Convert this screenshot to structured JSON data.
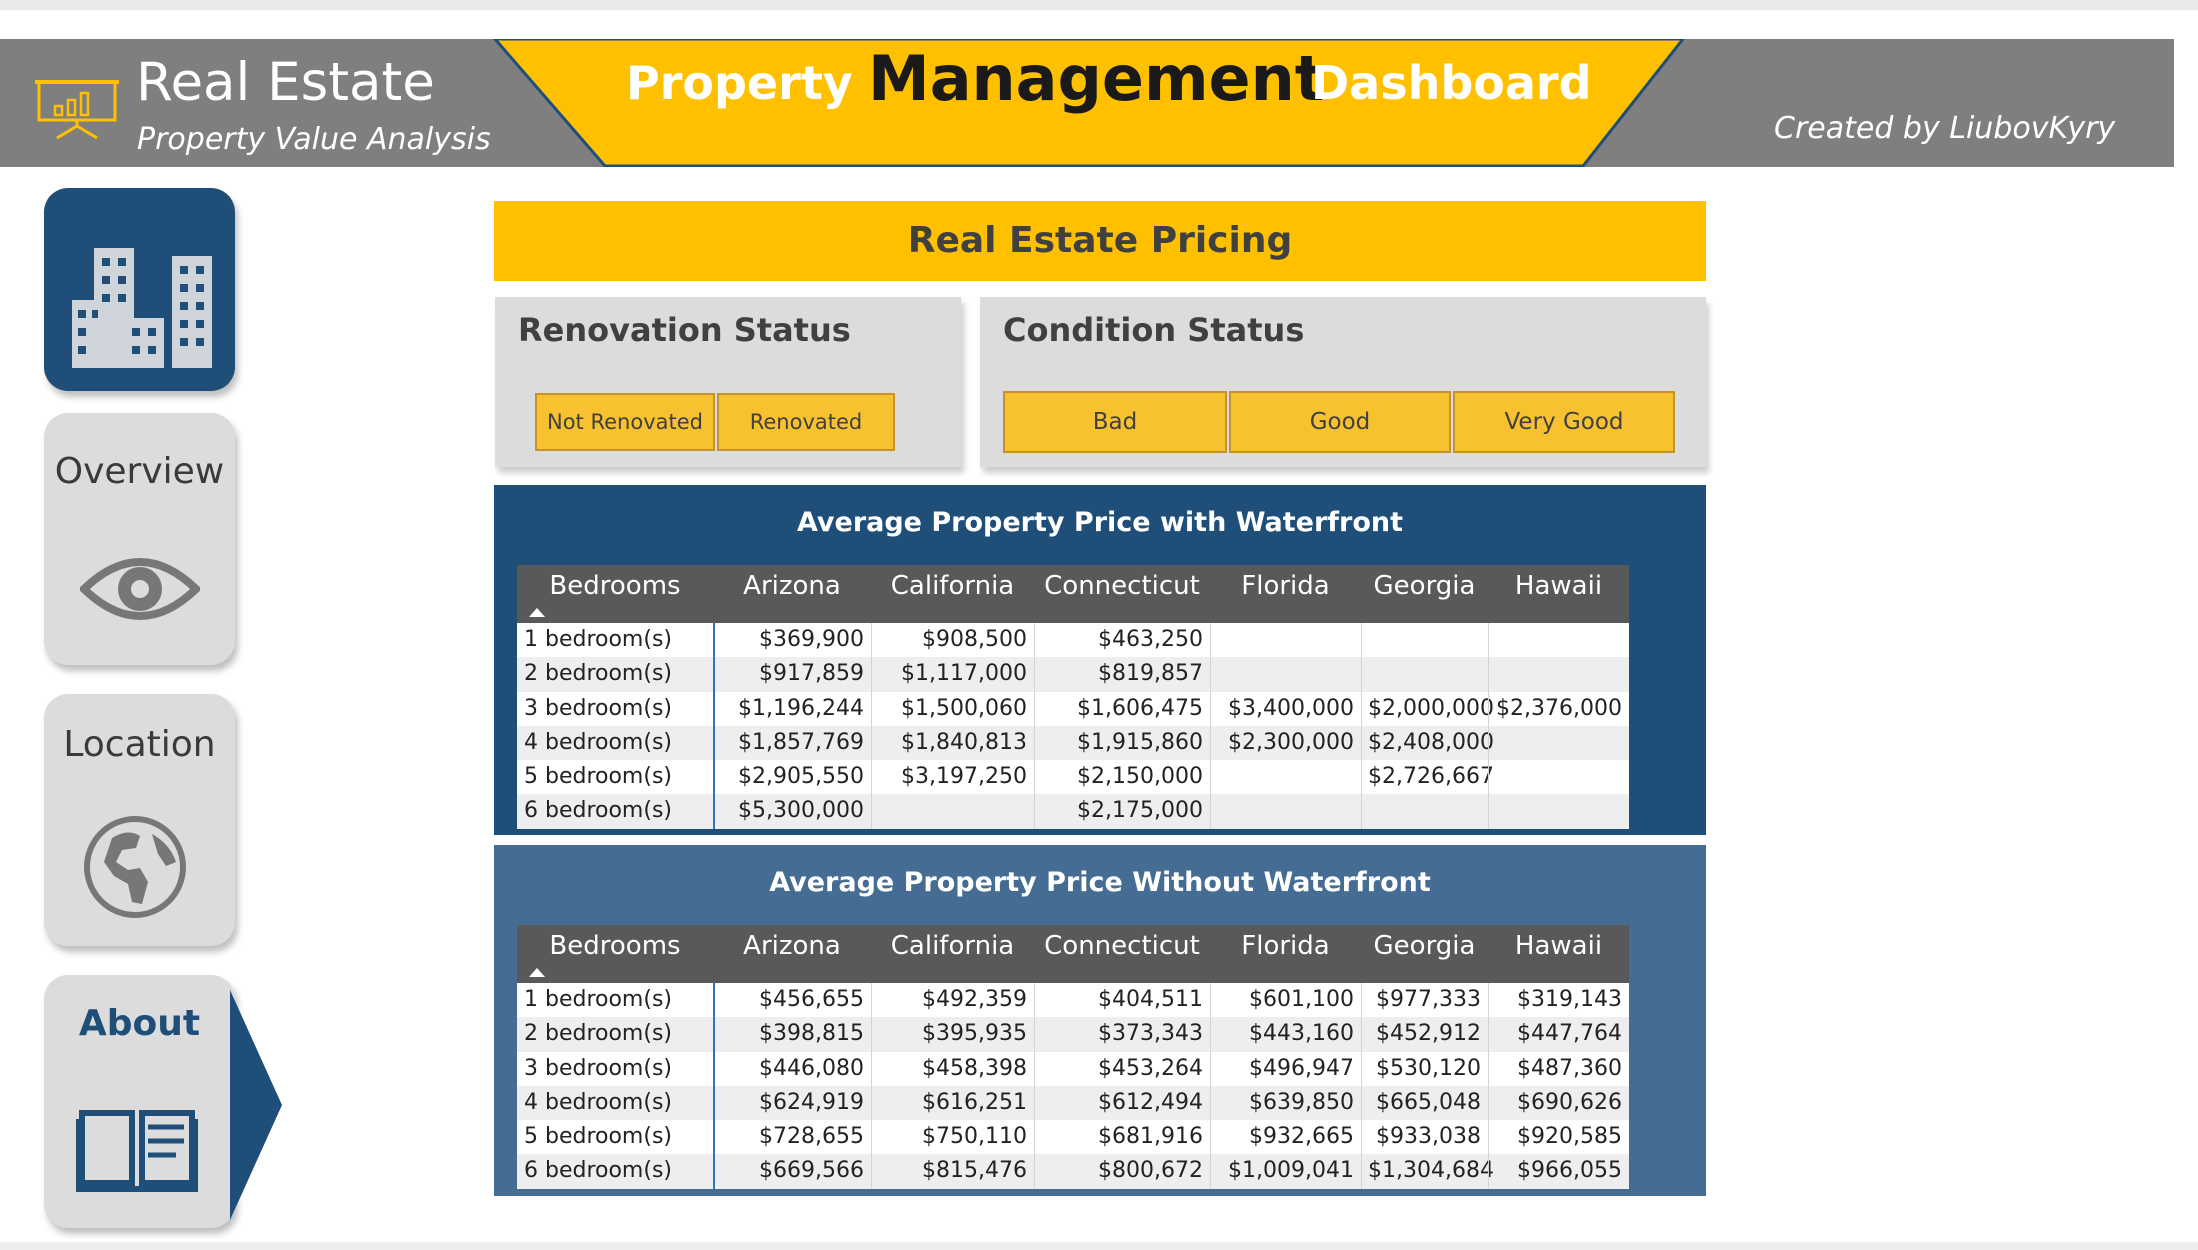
{
  "header": {
    "brand_title": "Real Estate",
    "brand_subtitle": "Property Value Analysis",
    "title_word1": "Property",
    "title_word2": "Management",
    "title_word3": "Dashboard",
    "credit": "Created by LiubovKyry"
  },
  "sidebar": {
    "items": [
      {
        "label": "",
        "icon": "buildings-icon"
      },
      {
        "label": "Overview",
        "icon": "eye-icon"
      },
      {
        "label": "Location",
        "icon": "globe-icon"
      },
      {
        "label": "About",
        "icon": "book-icon"
      }
    ]
  },
  "main": {
    "banner": "Real Estate Pricing",
    "renovation": {
      "title": "Renovation Status",
      "options": [
        "Not Renovated",
        "Renovated"
      ]
    },
    "condition": {
      "title": "Condition Status",
      "options": [
        "Bad",
        "Good",
        "Very Good"
      ]
    },
    "columns": [
      "Bedrooms",
      "Arizona",
      "California",
      "Connecticut",
      "Florida",
      "Georgia",
      "Hawaii"
    ],
    "waterfront": {
      "title": "Average Property Price with Waterfront",
      "rows": [
        [
          "1 bedroom(s)",
          "$369,900",
          "$908,500",
          "$463,250",
          "",
          "",
          ""
        ],
        [
          "2 bedroom(s)",
          "$917,859",
          "$1,117,000",
          "$819,857",
          "",
          "",
          ""
        ],
        [
          "3 bedroom(s)",
          "$1,196,244",
          "$1,500,060",
          "$1,606,475",
          "$3,400,000",
          "$2,000,000",
          "$2,376,000"
        ],
        [
          "4 bedroom(s)",
          "$1,857,769",
          "$1,840,813",
          "$1,915,860",
          "$2,300,000",
          "$2,408,000",
          ""
        ],
        [
          "5 bedroom(s)",
          "$2,905,550",
          "$3,197,250",
          "$2,150,000",
          "",
          "$2,726,667",
          ""
        ],
        [
          "6 bedroom(s)",
          "$5,300,000",
          "",
          "$2,175,000",
          "",
          "",
          ""
        ]
      ]
    },
    "no_waterfront": {
      "title": "Average Property Price Without Waterfront",
      "rows": [
        [
          "1 bedroom(s)",
          "$456,655",
          "$492,359",
          "$404,511",
          "$601,100",
          "$977,333",
          "$319,143"
        ],
        [
          "2 bedroom(s)",
          "$398,815",
          "$395,935",
          "$373,343",
          "$443,160",
          "$452,912",
          "$447,764"
        ],
        [
          "3 bedroom(s)",
          "$446,080",
          "$458,398",
          "$453,264",
          "$496,947",
          "$530,120",
          "$487,360"
        ],
        [
          "4 bedroom(s)",
          "$624,919",
          "$616,251",
          "$612,494",
          "$639,850",
          "$665,048",
          "$690,626"
        ],
        [
          "5 bedroom(s)",
          "$728,655",
          "$750,110",
          "$681,916",
          "$932,665",
          "$933,038",
          "$920,585"
        ],
        [
          "6 bedroom(s)",
          "$669,566",
          "$815,476",
          "$800,672",
          "$1,009,041",
          "$1,304,684",
          "$966,055"
        ]
      ]
    }
  },
  "colors": {
    "accent_yellow": "#ffc000",
    "navy": "#1f4e79",
    "steel_blue": "#456c92",
    "header_gray": "#7f7f7f",
    "chip_yellow": "#f8c130"
  }
}
